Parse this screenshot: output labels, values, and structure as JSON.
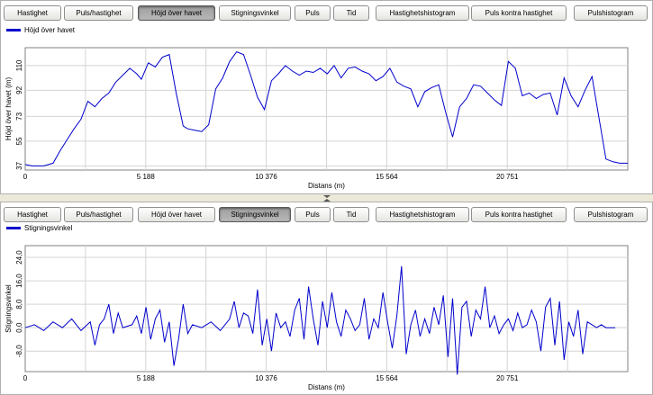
{
  "tabs": [
    {
      "label": "Hastighet"
    },
    {
      "label": "Puls/hastighet"
    },
    {
      "label": "Höjd över havet"
    },
    {
      "label": "Stigningsvinkel"
    },
    {
      "label": "Puls"
    },
    {
      "label": "Tid"
    },
    {
      "label": "Hastighetshistogram"
    },
    {
      "label": "Puls kontra hastighet"
    },
    {
      "label": "Pulshistogram"
    }
  ],
  "top_panel": {
    "active_tab": "Höjd över havet"
  },
  "bottom_panel": {
    "active_tab": "Stigningsvinkel"
  },
  "colors": {
    "series": "#0000cc",
    "grid": "#d4d4d4",
    "active_tab": "#a8a8a8"
  },
  "chart_data": [
    {
      "type": "line",
      "title": "",
      "legend": "Höjd över havet",
      "legend_position": "top-left",
      "xlabel": "Distans (m)",
      "ylabel": "Höjd över havet (m)",
      "x_ticks": [
        "0",
        "5 188",
        "10 376",
        "15 564",
        "20 751"
      ],
      "y_ticks": [
        "37",
        "55",
        "73",
        "92",
        "110"
      ],
      "xlim": [
        0,
        25940
      ],
      "ylim": [
        34,
        123
      ],
      "grid": true,
      "x": [
        0,
        300,
        800,
        1200,
        1500,
        1800,
        2100,
        2400,
        2700,
        3000,
        3300,
        3600,
        3900,
        4200,
        4500,
        4800,
        5000,
        5300,
        5600,
        5900,
        6200,
        6500,
        6800,
        7000,
        7300,
        7600,
        7900,
        8200,
        8500,
        8800,
        9100,
        9400,
        9700,
        10000,
        10300,
        10600,
        10900,
        11200,
        11500,
        11800,
        12100,
        12400,
        12700,
        13000,
        13300,
        13600,
        13900,
        14200,
        14500,
        14800,
        15100,
        15400,
        15700,
        16000,
        16300,
        16600,
        16900,
        17200,
        17500,
        17800,
        18100,
        18400,
        18700,
        19000,
        19300,
        19600,
        19900,
        20200,
        20500,
        20800,
        21100,
        21400,
        21700,
        22000,
        22300,
        22600,
        22900,
        23200,
        23500,
        23800,
        24100,
        24400,
        24700,
        25000,
        25300,
        25600,
        25940
      ],
      "y": [
        38,
        37,
        37,
        39,
        48,
        56,
        64,
        71,
        84,
        80,
        86,
        90,
        98,
        103,
        108,
        104,
        100,
        112,
        109,
        116,
        118,
        90,
        66,
        64,
        63,
        62,
        67,
        93,
        101,
        113,
        120,
        118,
        103,
        87,
        78,
        99,
        104,
        110,
        106,
        103,
        106,
        105,
        108,
        104,
        110,
        101,
        108,
        109,
        106,
        104,
        99,
        102,
        108,
        98,
        95,
        93,
        80,
        91,
        94,
        96,
        76,
        58,
        80,
        86,
        96,
        95,
        90,
        85,
        81,
        113,
        108,
        88,
        90,
        86,
        89,
        90,
        74,
        101,
        88,
        80,
        92,
        102,
        72,
        42,
        40,
        39,
        39
      ]
    },
    {
      "type": "line",
      "title": "",
      "legend": "Stigningsvinkel",
      "legend_position": "top-left",
      "xlabel": "Distans (m)",
      "ylabel": "Stigningsvinkel",
      "x_ticks": [
        "0",
        "5 188",
        "10 376",
        "15 564",
        "20 751"
      ],
      "y_ticks": [
        "-8,0",
        "0,0",
        "8,0",
        "16,0",
        "24,0"
      ],
      "xlim": [
        0,
        25940
      ],
      "ylim": [
        -15,
        28
      ],
      "grid": true,
      "x": [
        0,
        400,
        800,
        1200,
        1600,
        2000,
        2400,
        2800,
        3000,
        3200,
        3400,
        3600,
        3800,
        4000,
        4200,
        4600,
        4800,
        5000,
        5200,
        5400,
        5600,
        5800,
        6000,
        6200,
        6400,
        6600,
        6800,
        7000,
        7200,
        7600,
        8000,
        8400,
        8800,
        9000,
        9200,
        9400,
        9600,
        9800,
        10000,
        10200,
        10400,
        10600,
        10800,
        11000,
        11200,
        11400,
        11600,
        11800,
        12000,
        12200,
        12400,
        12600,
        12800,
        13000,
        13200,
        13400,
        13600,
        13800,
        14000,
        14200,
        14400,
        14600,
        14800,
        15000,
        15200,
        15400,
        15600,
        15800,
        16000,
        16200,
        16400,
        16600,
        16800,
        17000,
        17200,
        17400,
        17600,
        17800,
        18000,
        18200,
        18400,
        18600,
        18800,
        19000,
        19200,
        19400,
        19600,
        19800,
        20000,
        20200,
        20400,
        20600,
        20800,
        21000,
        21200,
        21400,
        21600,
        21800,
        22000,
        22200,
        22400,
        22600,
        22800,
        23000,
        23200,
        23400,
        23600,
        23800,
        24000,
        24200,
        24400,
        24600,
        24800,
        25000,
        25400,
        25940
      ],
      "y": [
        0,
        1,
        -1,
        2,
        0,
        3,
        -1,
        2,
        -6,
        1,
        3,
        8,
        -2,
        5,
        0,
        1,
        4,
        -2,
        7,
        -4,
        3,
        6,
        -5,
        2,
        -13,
        -4,
        8,
        -2,
        1,
        0,
        2,
        -1,
        3,
        9,
        0,
        5,
        4,
        -2,
        13,
        -6,
        3,
        -8,
        5,
        0,
        2,
        -3,
        6,
        10,
        -4,
        14,
        3,
        -6,
        9,
        0,
        12,
        2,
        -3,
        6,
        3,
        -1,
        1,
        10,
        -4,
        3,
        0,
        12,
        2,
        -7,
        4,
        21,
        -9,
        1,
        6,
        -3,
        3,
        -2,
        7,
        1,
        11,
        -10,
        10,
        -16,
        7,
        9,
        -3,
        6,
        3,
        14,
        0,
        4,
        -2,
        1,
        3,
        -1,
        5,
        0,
        1,
        6,
        2,
        -8,
        7,
        10,
        -6,
        9,
        -11,
        2,
        -3,
        6,
        -9,
        2,
        1,
        0,
        1,
        0,
        0
      ]
    }
  ]
}
